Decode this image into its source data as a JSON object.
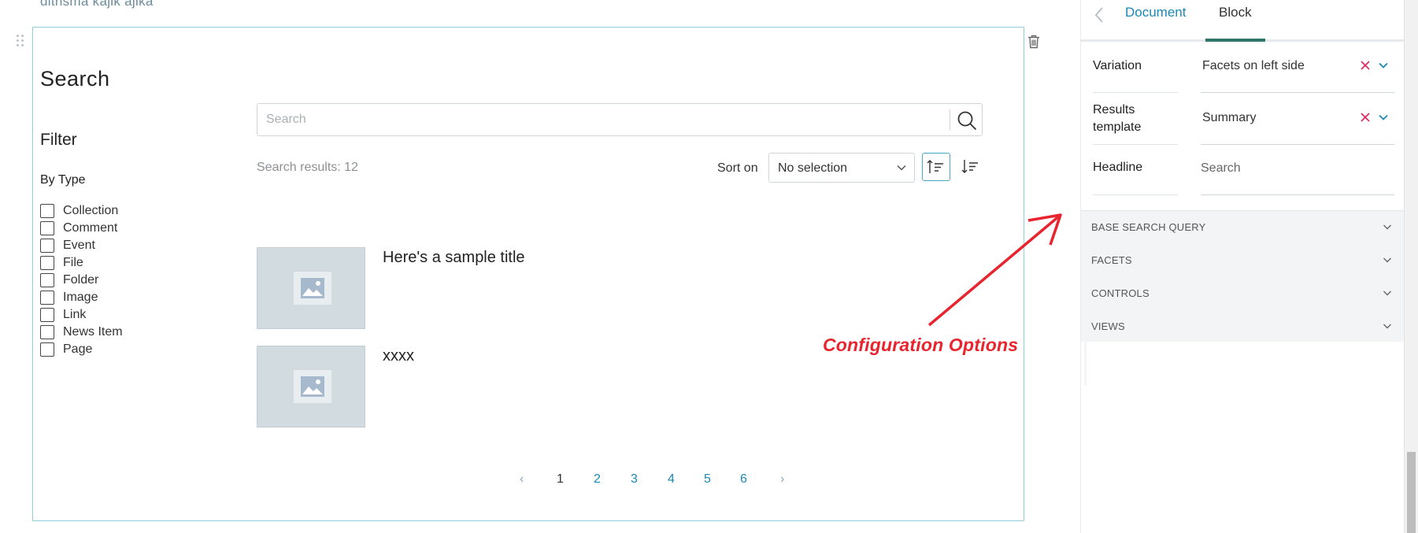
{
  "page": {
    "top_text": "dithsma kajik  ajika"
  },
  "block": {
    "title": "Search",
    "filter_title": "Filter",
    "facet_group": "By Type",
    "facets": [
      "Collection",
      "Comment",
      "Event",
      "File",
      "Folder",
      "Image",
      "Link",
      "News Item",
      "Page"
    ],
    "search_placeholder": "Search",
    "results_label": "Search results: 12",
    "sort_label": "Sort on",
    "sort_value": "No selection",
    "results": [
      {
        "title": "Here's a sample title"
      },
      {
        "title": "xxxx"
      }
    ],
    "pagination": {
      "prev": "‹",
      "next": "›",
      "pages": [
        "1",
        "2",
        "3",
        "4",
        "5",
        "6"
      ],
      "current": "1"
    }
  },
  "annotation": {
    "text": "Configuration Options",
    "color": "#e8242f"
  },
  "sidebar": {
    "tabs": {
      "document": "Document",
      "block": "Block",
      "active": "Block"
    },
    "fields": {
      "variation": {
        "label": "Variation",
        "value": "Facets on left side"
      },
      "results_template": {
        "label_line1": "Results",
        "label_line2": "template",
        "value": "Summary"
      },
      "headline": {
        "label": "Headline",
        "placeholder": "Search"
      }
    },
    "accordions": [
      "BASE SEARCH QUERY",
      "FACETS",
      "CONTROLS",
      "VIEWS"
    ]
  },
  "colors": {
    "link": "#1c88b6",
    "block_border": "#8fd0dc",
    "active_tab_underline": "#2f7569",
    "clear_x": "#e0245e"
  },
  "icons": {
    "trash": "trash-icon",
    "drag": "drag-handle-icon",
    "search": "search-icon",
    "image_placeholder": "image-placeholder-icon",
    "sort_ascending": "sort-ascending-icon",
    "sort_descending": "sort-descending-icon"
  }
}
